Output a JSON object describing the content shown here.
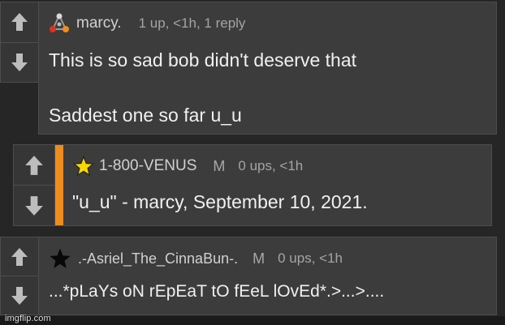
{
  "comments": [
    {
      "username": "marcy.",
      "mod_tag": "",
      "stats": "1 up, <1h, 1 reply",
      "lines": [
        "This is so sad bob didn't deserve that",
        "Saddest one so far u_u"
      ],
      "icon": "triangle-dots-icon"
    },
    {
      "username": "1-800-VENUS",
      "mod_tag": "M",
      "stats": "0 ups, <1h",
      "lines": [
        "\"u_u\" - marcy, September 10, 2021."
      ],
      "icon": "yellow-star-icon"
    },
    {
      "username": ".-Asriel_The_CinnaBun-.",
      "mod_tag": "M",
      "stats": "0 ups, <1h",
      "lines": [
        "...*pLaYs oN rEpEaT tO fEeL lOvEd*.>...>...."
      ],
      "icon": "black-star-icon"
    }
  ],
  "watermark": "imgflip.com",
  "colors": {
    "accent": "#f08c1c",
    "star_yellow": "#f5d800",
    "panel": "#3c3c3c",
    "background": "#262626"
  }
}
